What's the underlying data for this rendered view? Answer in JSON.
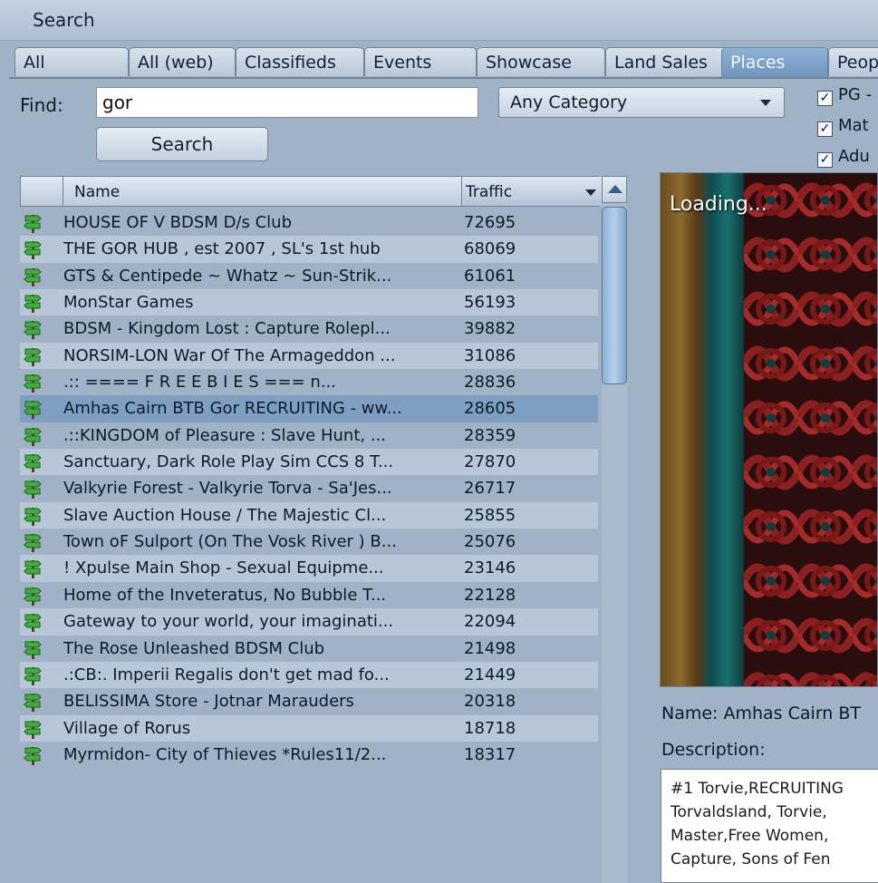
{
  "window": {
    "title": "Search"
  },
  "tabs": [
    {
      "label": "All",
      "active": false
    },
    {
      "label": "All (web)",
      "active": false
    },
    {
      "label": "Classifieds",
      "active": false
    },
    {
      "label": "Events",
      "active": false
    },
    {
      "label": "Showcase",
      "active": false
    },
    {
      "label": "Land Sales",
      "active": false
    },
    {
      "label": "Places",
      "active": true
    },
    {
      "label": "Peop",
      "active": false
    }
  ],
  "search": {
    "find_label": "Find:",
    "query": "gor",
    "category": "Any Category",
    "button_label": "Search",
    "checkboxes": [
      {
        "label": "PG -",
        "checked": true
      },
      {
        "label": "Mat",
        "checked": true
      },
      {
        "label": "Adu",
        "checked": true
      }
    ]
  },
  "results": {
    "columns": {
      "name": "Name",
      "traffic": "Traffic"
    },
    "scroll_position": 0.0,
    "rows": [
      {
        "name": "HOUSE OF V  BDSM D/s Club",
        "traffic": "72695"
      },
      {
        "name": "THE GOR HUB , est 2007 , SL's 1st hub",
        "traffic": "68069"
      },
      {
        "name": "GTS & Centipede ~ Whatz ~ Sun-Strik...",
        "traffic": "61061"
      },
      {
        "name": "MonStar Games",
        "traffic": "56193"
      },
      {
        "name": "BDSM - Kingdom Lost : Capture Rolepl...",
        "traffic": "39882"
      },
      {
        "name": "NORSIM-LON War Of The Armageddon ...",
        "traffic": "31086"
      },
      {
        "name": ".:: ====  F  R  E  E  B  I  E  S  === n...",
        "traffic": "28836"
      },
      {
        "name": "Amhas Cairn BTB Gor RECRUITING - ww...",
        "traffic": "28605",
        "selected": true
      },
      {
        "name": ".::KINGDOM of Pleasure : Slave Hunt, ...",
        "traffic": "28359"
      },
      {
        "name": "Sanctuary, Dark Role Play Sim CCS 8 T...",
        "traffic": "27870"
      },
      {
        "name": "Valkyrie Forest - Valkyrie Torva - Sa'Jes...",
        "traffic": "26717"
      },
      {
        "name": "Slave Auction House / The Majestic Cl...",
        "traffic": "25855"
      },
      {
        "name": "Town oF Sulport (On The Vosk River ) B...",
        "traffic": "25076"
      },
      {
        "name": "! Xpulse Main Shop - Sexual Equipme...",
        "traffic": "23146"
      },
      {
        "name": "Home of the Inveteratus, No Bubble T...",
        "traffic": "22128"
      },
      {
        "name": "Gateway to your world, your imaginati...",
        "traffic": "22094"
      },
      {
        "name": "The Rose Unleashed BDSM Club",
        "traffic": "21498"
      },
      {
        "name": ".:CB:. Imperii Regalis  don't get mad fo...",
        "traffic": "21449"
      },
      {
        "name": "BELISSIMA Store - Jotnar Marauders",
        "traffic": "20318"
      },
      {
        "name": "Village of Rorus",
        "traffic": "18718"
      },
      {
        "name": "Myrmidon- City of Thieves *Rules11/2...",
        "traffic": "18317"
      }
    ]
  },
  "detail": {
    "loading_text": "Loading...",
    "name_line": "Name:  Amhas Cairn BT",
    "description_label": "Description:",
    "description_lines": [
      "#1 Torvie,RECRUITING",
      "Torvaldsland, Torvie,",
      "Master,Free Women,",
      "Capture, Sons of Fen"
    ]
  },
  "colors": {
    "panel_bg": "#9fb2c6",
    "row_alt": "#b7c7d8",
    "row_selected": "#7f9fc2",
    "active_tab": "#7fa4ca"
  },
  "icons": {
    "row_icon": "signpost-icon",
    "sort": "chevron-down-icon"
  }
}
